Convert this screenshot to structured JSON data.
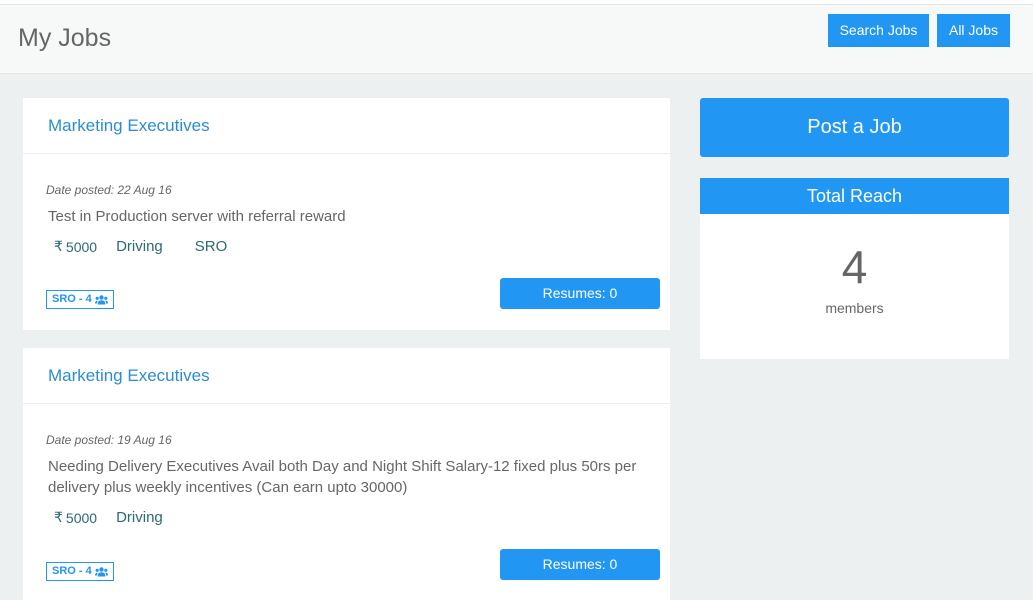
{
  "header": {
    "title": "My Jobs",
    "search_jobs_label": "Search Jobs",
    "all_jobs_label": "All Jobs"
  },
  "jobs": [
    {
      "title": "Marketing Executives",
      "date_posted": "Date posted: 22 Aug 16",
      "description": "Test in Production server with referral reward",
      "salary": "5000",
      "category": "Driving",
      "location": "SRO",
      "badge": "SRO - 4",
      "resumes_label": "Resumes: 0"
    },
    {
      "title": "Marketing Executives",
      "date_posted": "Date posted: 19 Aug 16",
      "description": "Needing Delivery Executives Avail both Day and Night Shift Salary-12 fixed plus 50rs per delivery plus weekly incentives (Can earn upto 30000)",
      "salary": "5000",
      "category": "Driving",
      "location": "",
      "badge": "SRO - 4",
      "resumes_label": "Resumes: 0"
    }
  ],
  "sidebar": {
    "post_job_label": "Post a Job",
    "reach_title": "Total Reach",
    "reach_count": "4",
    "reach_unit": "members"
  },
  "icons": {
    "currency": "rupee-icon",
    "group": "users-icon"
  },
  "colors": {
    "accent": "#2196f3",
    "link": "#2a8dd4",
    "meta_text": "#2a6b73",
    "background": "#ecf0f1"
  }
}
